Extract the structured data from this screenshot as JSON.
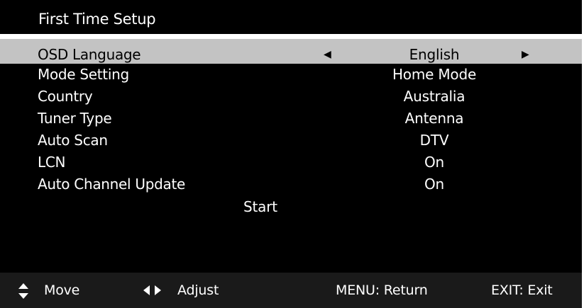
{
  "header": {
    "title": "First Time Setup"
  },
  "menu": {
    "items": [
      {
        "label": "OSD Language",
        "value": "English",
        "selected": true,
        "left_arrow": "◀",
        "right_arrow": "▶"
      },
      {
        "label": "Mode Setting",
        "value": "Home Mode"
      },
      {
        "label": "Country",
        "value": "Australia"
      },
      {
        "label": "Tuner Type",
        "value": "Antenna"
      },
      {
        "label": "Auto Scan",
        "value": "DTV"
      },
      {
        "label": "LCN",
        "value": "On"
      },
      {
        "label": "Auto Channel Update",
        "value": "On"
      }
    ],
    "start_label": "Start"
  },
  "footer": {
    "move_label": "Move",
    "move_icon": "up-down-arrows-icon",
    "adjust_label": "Adjust",
    "adjust_icon": "left-right-arrows-icon",
    "menu_label": "MENU: Return",
    "exit_label": "EXIT: Exit"
  },
  "colors": {
    "background": "#000000",
    "text": "#ffffff",
    "highlight": "#c3c3c3",
    "footer_bg": "#1a1a1a"
  }
}
